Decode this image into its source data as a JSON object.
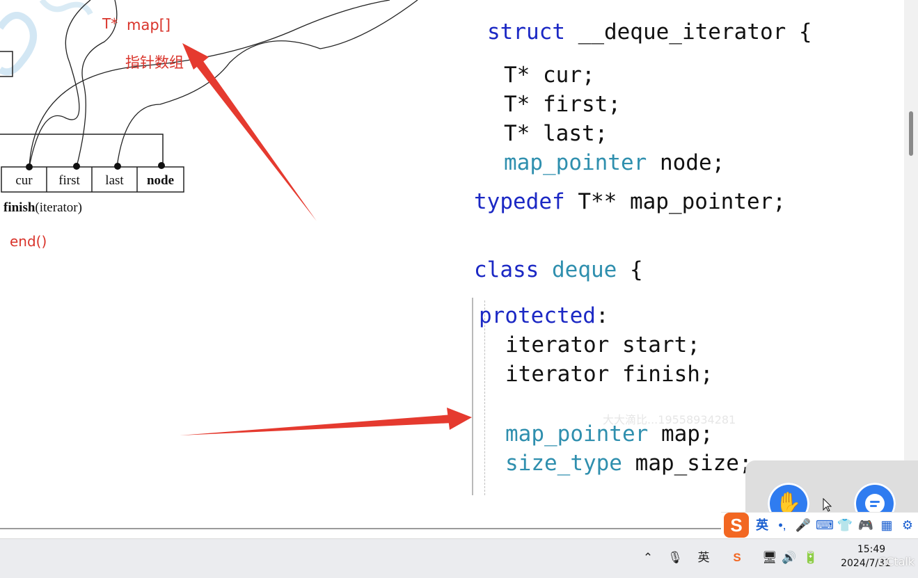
{
  "diagram": {
    "pointer_type": "T*",
    "map_label": "map[]",
    "map_note": "指针数组",
    "fields": [
      "cur",
      "first",
      "last",
      "node"
    ],
    "iterator_bold": "finish",
    "iterator_rest": "(iterator)",
    "end_note": "end()"
  },
  "code": {
    "struct_kw": "struct",
    "struct_name": "__deque_iterator {",
    "member_type_ptr": "T*",
    "member_cur": "cur;",
    "member_first": "first;",
    "member_last": "last;",
    "member_node_type": "map_pointer",
    "member_node": "node;",
    "typedef_kw": "typedef",
    "typedef_rest": "T** map_pointer;",
    "class_kw": "class",
    "class_name": "deque",
    "class_brace": "{",
    "access_kw": "protected",
    "access_colon": ":",
    "line_start": "iterator start;",
    "line_finish": "iterator finish;",
    "map_type": "map_pointer",
    "map_var": "map;",
    "size_type": "size_type",
    "size_var": "map_size;"
  },
  "watermark": "大大滴比...19558934281",
  "ime": {
    "logo": "S",
    "lang": "英",
    "punct": "•,"
  },
  "taskbar": {
    "lang": "英",
    "time": "15:49",
    "date": "2024/7/31",
    "brand": "CCtalk"
  },
  "colors": {
    "keyword": "#1b28c4",
    "type": "#2f8fae",
    "annotation_red": "#d9342b",
    "floating_button": "#2f7cf0"
  }
}
